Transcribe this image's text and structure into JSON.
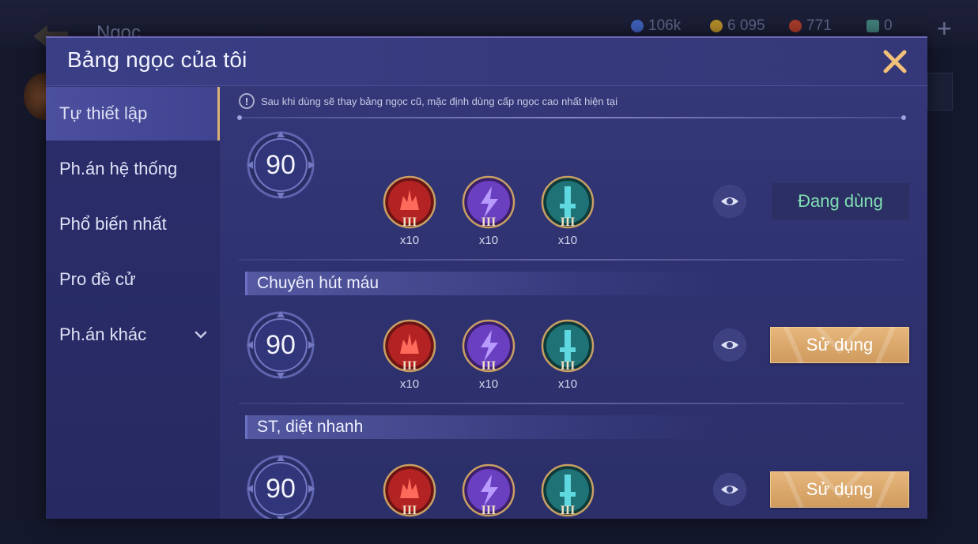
{
  "background": {
    "page_title": "Ngọc",
    "resources": [
      {
        "icon": "blue-coin-icon",
        "value": "106k",
        "color": "#3e5fb8"
      },
      {
        "icon": "gold-coin-icon",
        "value": "6 095",
        "color": "#b08a2a"
      },
      {
        "icon": "red-gem-icon",
        "value": "771",
        "color": "#a53a2a"
      },
      {
        "icon": "ticket-icon",
        "value": "0",
        "color": "#3f7c78"
      }
    ]
  },
  "modal": {
    "title": "Bảng ngọc của tôi",
    "notice": "Sau khi dùng sẽ thay bảng ngọc cũ, mặc định dùng cấp ngọc cao nhất hiện tại",
    "sidebar": [
      {
        "label": "Tự thiết lập",
        "active": true
      },
      {
        "label": "Ph.án hệ thống",
        "active": false
      },
      {
        "label": "Phổ biến nhất",
        "active": false
      },
      {
        "label": "Pro đề cử",
        "active": false
      },
      {
        "label": "Ph.án khác",
        "active": false,
        "has_dropdown": true
      }
    ],
    "rows": [
      {
        "section_title": "",
        "level": "90",
        "gems": [
          {
            "icon": "red-gem-icon",
            "tier": "III",
            "count": "x10"
          },
          {
            "icon": "purple-gem-icon",
            "tier": "III",
            "count": "x10"
          },
          {
            "icon": "green-gem-icon",
            "tier": "III",
            "count": "x10"
          }
        ],
        "button_label": "Đang dùng",
        "in_use": true
      },
      {
        "section_title": "Chuyên hút máu",
        "level": "90",
        "gems": [
          {
            "icon": "red-gem-icon",
            "tier": "III",
            "count": "x10"
          },
          {
            "icon": "purple-gem-icon",
            "tier": "III",
            "count": "x10"
          },
          {
            "icon": "green-gem-icon",
            "tier": "III",
            "count": "x10"
          }
        ],
        "button_label": "Sử dụng",
        "in_use": false
      },
      {
        "section_title": "ST, diệt nhanh",
        "level": "90",
        "gems": [
          {
            "icon": "red-gem-icon",
            "tier": "III",
            "count": "x10"
          },
          {
            "icon": "purple-gem-icon",
            "tier": "III",
            "count": "x10"
          },
          {
            "icon": "green-gem-icon",
            "tier": "III",
            "count": "x10"
          }
        ],
        "button_label": "Sử dụng",
        "in_use": false
      }
    ]
  },
  "colors": {
    "accent_gold": "#e8b97c",
    "close_icon": "#f3c17a",
    "in_use_text": "#7fe0b4"
  }
}
